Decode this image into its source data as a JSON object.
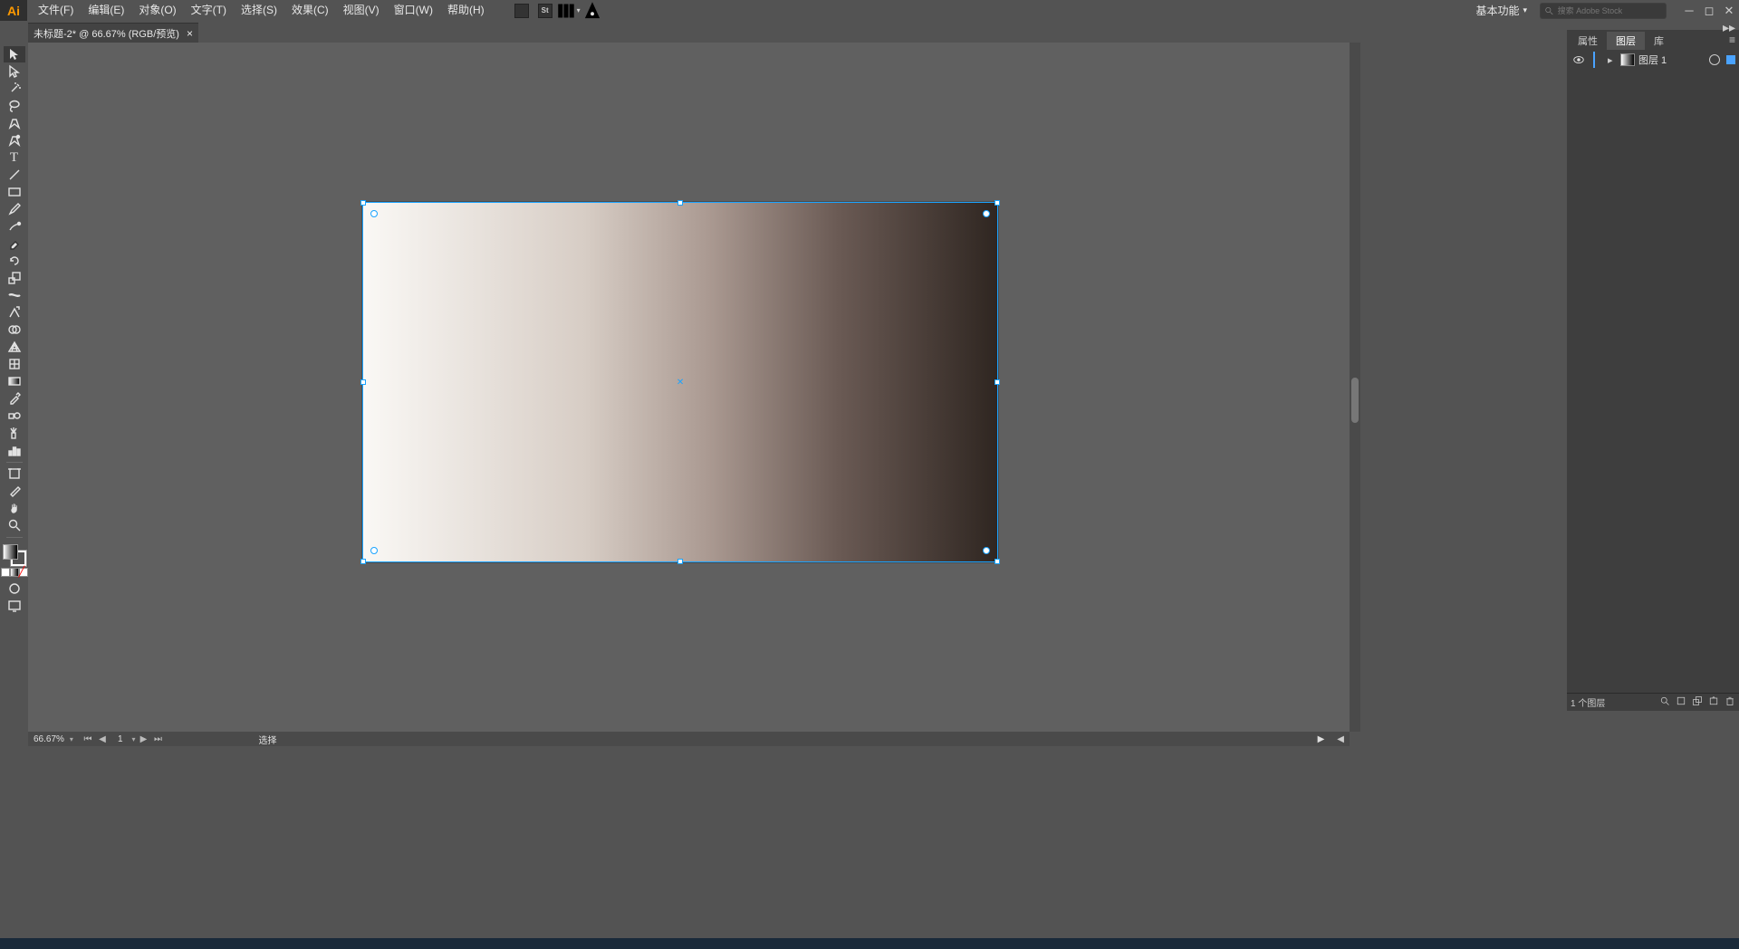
{
  "menubar": {
    "items": [
      "文件(F)",
      "编辑(E)",
      "对象(O)",
      "文字(T)",
      "选择(S)",
      "效果(C)",
      "视图(V)",
      "窗口(W)",
      "帮助(H)"
    ],
    "workspace": "基本功能",
    "search_placeholder": "搜索 Adobe Stock"
  },
  "document": {
    "tab_title": "未标题-2* @ 66.67% (RGB/预览)"
  },
  "status": {
    "zoom": "66.67%",
    "artboard": "1",
    "tool": "选择"
  },
  "panels": {
    "tabs": {
      "properties": "属性",
      "layers": "图层",
      "libraries": "库"
    },
    "layer": {
      "name": "图层 1",
      "footer": "1 个图层"
    }
  },
  "icons": {
    "st": "St"
  }
}
